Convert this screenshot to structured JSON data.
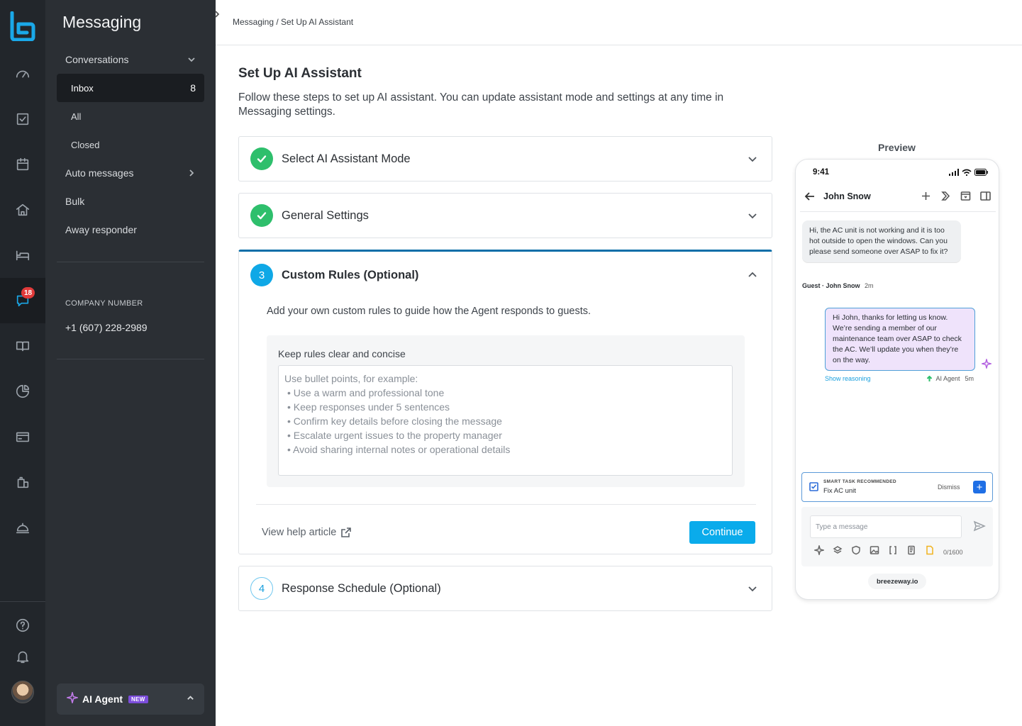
{
  "app": {
    "section_title": "Messaging",
    "rail_badge": "18"
  },
  "sidebar": {
    "conversations": "Conversations",
    "inbox": "Inbox",
    "inbox_count": "8",
    "all": "All",
    "closed": "Closed",
    "auto_messages": "Auto messages",
    "bulk": "Bulk",
    "away_responder": "Away responder",
    "company_label": "COMPANY NUMBER",
    "company_number": "+1 (607) 228-2989",
    "ai_agent": "AI Agent",
    "ai_agent_badge": "NEW"
  },
  "header": {
    "breadcrumb": "Messaging / Set Up AI Assistant"
  },
  "main": {
    "title": "Set Up AI Assistant",
    "description": "Follow these steps to set up AI assistant. You can update assistant mode and settings at any time in Messaging settings.",
    "steps": [
      {
        "number": "1",
        "title": "Select AI Assistant Mode",
        "status": "done"
      },
      {
        "number": "2",
        "title": "General Settings",
        "status": "done"
      },
      {
        "number": "3",
        "title": "Custom Rules (Optional)",
        "status": "active"
      },
      {
        "number": "4",
        "title": "Response Schedule (Optional)",
        "status": "todo"
      }
    ],
    "custom_rules": {
      "description": "Add your own custom rules to guide how the Agent responds to guests.",
      "field_label": "Keep rules clear and concise",
      "placeholder_intro": "Use bullet points, for example:",
      "placeholder_bullets": [
        "• Use a warm and professional tone",
        "• Keep responses under 5 sentences",
        "• Confirm key details before closing the message",
        "• Escalate urgent issues to the property manager",
        "• Avoid sharing internal notes or operational details"
      ],
      "help_link": "View help article",
      "continue": "Continue"
    }
  },
  "preview": {
    "label": "Preview",
    "time": "9:41",
    "contact": "John Snow",
    "guest_message": "Hi, the AC unit is not working and it is too hot outside to open the windows. Can you please send someone over ASAP to fix it?",
    "guest_meta_name": "Guest · John Snow",
    "guest_meta_time": "2m",
    "agent_message": "Hi John, thanks for letting us know. We’re sending a member of our maintenance team over ASAP to check the AC. We’ll update you when they’re on the way.",
    "show_reasoning": "Show reasoning",
    "agent_meta_name": "AI Agent",
    "agent_meta_time": "5m",
    "smart_task_label": "SMART TASK RECOMMENDED",
    "smart_task_value": "Fix AC unit",
    "dismiss": "Dismiss",
    "input_placeholder": "Type a message",
    "char_count": "0/1600",
    "url": "breezeway.io"
  },
  "colors": {
    "accent": "#0aabeb",
    "success": "#2ebf6c",
    "rail_bg": "#22262b",
    "subnav_bg": "#2b2f34",
    "badge": "#e03a3a"
  }
}
